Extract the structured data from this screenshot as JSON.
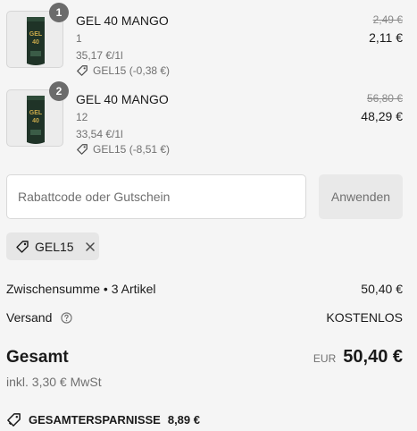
{
  "items": [
    {
      "badge": "1",
      "name": "GEL 40 MANGO",
      "qty": "1",
      "unit_price": "35,17 €/1l",
      "discount": "GEL15 (-0,38 €)",
      "price_old": "2,49 €",
      "price_new": "2,11 €",
      "icon": "product-gel-pack"
    },
    {
      "badge": "2",
      "name": "GEL 40 MANGO",
      "qty": "12",
      "unit_price": "33,54 €/1l",
      "discount": "GEL15 (-8,51 €)",
      "price_old": "56,80 €",
      "price_new": "48,29 €",
      "icon": "product-gel-pack"
    }
  ],
  "discount_form": {
    "placeholder": "Rabattcode oder Gutschein",
    "value": "",
    "apply_label": "Anwenden"
  },
  "applied_code": {
    "label": "GEL15",
    "icon": "tag-icon"
  },
  "summary": {
    "subtotal_label": "Zwischensumme • 3 Artikel",
    "subtotal_value": "50,40 €",
    "shipping_label": "Versand",
    "shipping_value": "KOSTENLOS",
    "total_label": "Gesamt",
    "currency": "EUR",
    "total_value": "50,40 €",
    "vat_note": "inkl. 3,30 € MwSt",
    "savings_label": "GESAMTERSPARNISSE",
    "savings_value": "8,89 €"
  },
  "colors": {
    "background": "#f5f5f5",
    "text": "#1a1a1a",
    "muted": "#707070",
    "product_dark_green": "#1f3327",
    "product_gold": "#c9a94b"
  }
}
